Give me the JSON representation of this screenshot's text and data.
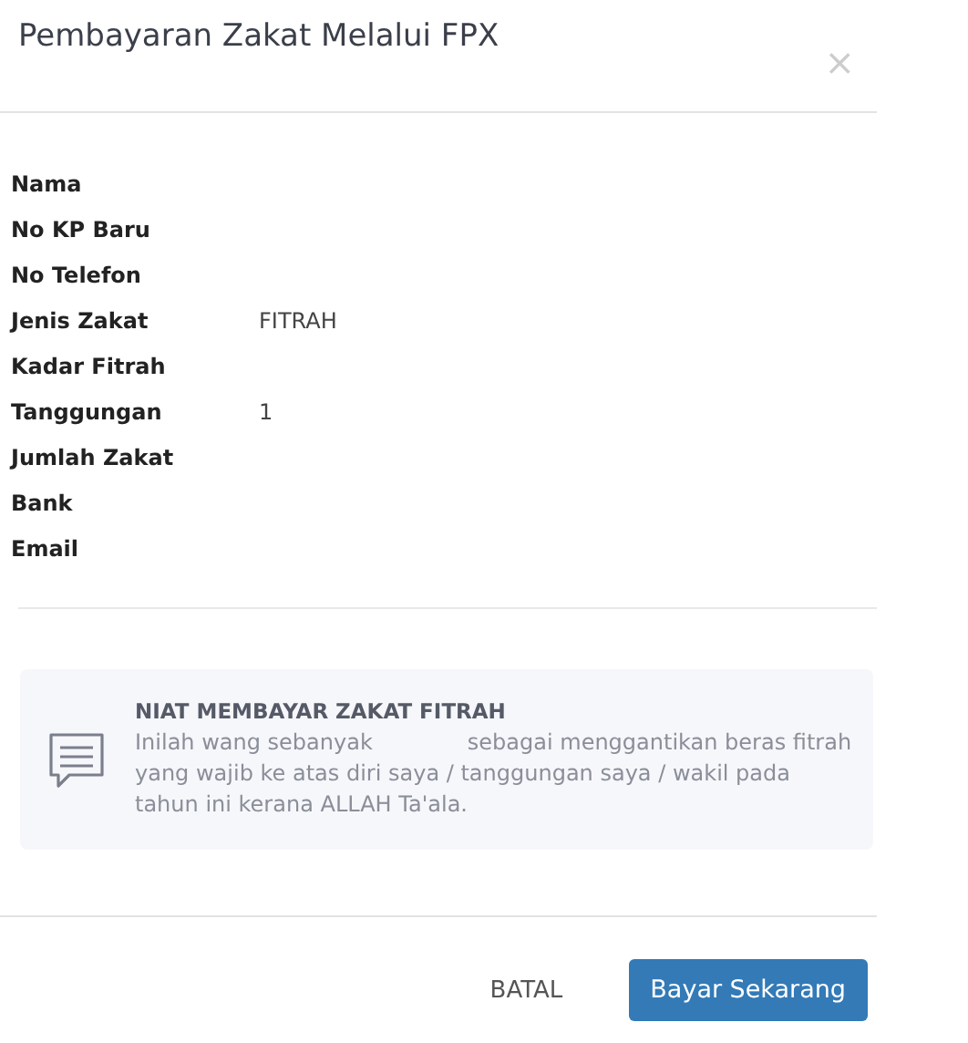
{
  "title": "Pembayaran Zakat Melalui FPX",
  "close": "×",
  "fields": [
    {
      "label": "Nama"
    },
    {
      "label": "No KP Baru"
    },
    {
      "label": "No Telefon"
    },
    {
      "label": "Jenis Zakat",
      "value": "FITRAH"
    },
    {
      "label": "Kadar Fitrah"
    },
    {
      "label": "Tanggungan",
      "value": "1"
    },
    {
      "label": "Jumlah Zakat"
    },
    {
      "label": "Bank"
    },
    {
      "label": "Email"
    }
  ],
  "notice": {
    "heading": "NIAT MEMBAYAR ZAKAT FITRAH",
    "text_before": "Inilah wang sebanyak",
    "text_after": "sebagai menggantikan beras fitrah yang wajib ke atas diri saya / tanggungan saya / wakil pada tahun ini kerana ALLAH Ta'ala."
  },
  "buttons": {
    "cancel": "BATAL",
    "submit": "Bayar Sekarang"
  }
}
